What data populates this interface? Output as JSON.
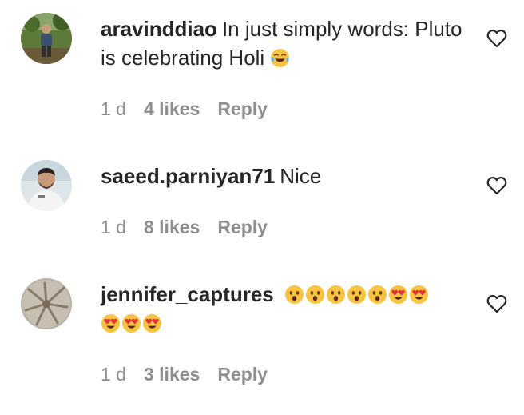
{
  "comments": [
    {
      "username": "aravinddiao",
      "text": "In just simply words: Pluto is celebrating Holi",
      "emoji": [
        "face-with-tears-of-joy"
      ],
      "time": "1 d",
      "likes": "4 likes",
      "reply": "Reply"
    },
    {
      "username": "saeed.parniyan71",
      "text": "Nice",
      "emoji": [],
      "time": "1 d",
      "likes": "8 likes",
      "reply": "Reply"
    },
    {
      "username": "jennifer_captures",
      "text": "",
      "emoji": [
        "hushed-face",
        "hushed-face",
        "hushed-face",
        "hushed-face",
        "hushed-face",
        "heart-eyes-face",
        "heart-eyes-face",
        "heart-eyes-face",
        "heart-eyes-face",
        "heart-eyes-face"
      ],
      "time": "1 d",
      "likes": "3 likes",
      "reply": "Reply"
    }
  ],
  "colors": {
    "text": "#262626",
    "meta": "#8e8e8e",
    "emoji_yellow": "#f7c340",
    "emoji_heart": "#e8303a"
  }
}
